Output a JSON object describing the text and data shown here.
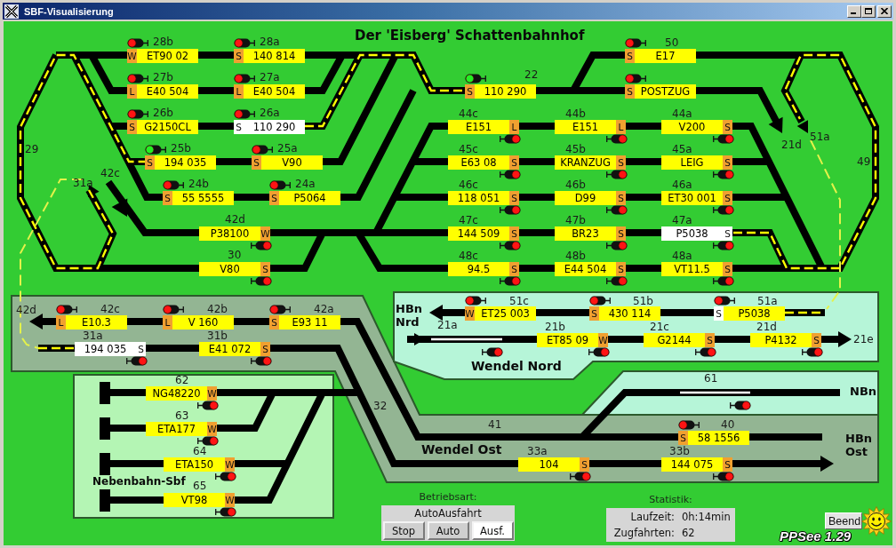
{
  "window": {
    "title": "SBF-Visualisierung"
  },
  "heading": "Der 'Eisberg' Schattenbahnhof",
  "blocks": [
    {
      "number": "28b",
      "train": "ET90 02",
      "letter": "W",
      "highlighted": false,
      "letter_highlighted": false,
      "signal_clear": false
    },
    {
      "number": "28a",
      "train": "140 814",
      "letter": "S",
      "highlighted": false,
      "letter_highlighted": false,
      "signal_clear": false
    },
    {
      "number": "50",
      "train": "E17",
      "letter": "S",
      "highlighted": false,
      "letter_highlighted": false,
      "signal_clear": false
    },
    {
      "number": "27b",
      "train": "E40 504",
      "letter": "L",
      "highlighted": false,
      "letter_highlighted": false,
      "signal_clear": false
    },
    {
      "number": "27a",
      "train": "E40 504",
      "letter": "L",
      "highlighted": false,
      "letter_highlighted": false,
      "signal_clear": false
    },
    {
      "number": "22",
      "train": "110 290",
      "letter": "S",
      "highlighted": false,
      "letter_highlighted": false,
      "signal_clear": true
    },
    {
      "train": "POSTZUG",
      "letter": "S",
      "highlighted": false,
      "letter_highlighted": false,
      "signal_clear": false
    },
    {
      "number": "26b",
      "train": "G2150CL",
      "letter": "S",
      "highlighted": false,
      "letter_highlighted": false,
      "signal_clear": false
    },
    {
      "number": "26a",
      "train": "110 290",
      "letter": "S",
      "highlighted": true,
      "letter_highlighted": true,
      "signal_clear": false
    },
    {
      "number": "44c",
      "train": "E151",
      "letter": "L",
      "highlighted": false,
      "letter_highlighted": false,
      "signal_clear": false
    },
    {
      "number": "44b",
      "train": "E151",
      "letter": "L",
      "highlighted": false,
      "letter_highlighted": false,
      "signal_clear": false
    },
    {
      "number": "44a",
      "train": "V200",
      "letter": "S",
      "highlighted": false,
      "letter_highlighted": false,
      "signal_clear": false
    },
    {
      "number": "25b",
      "train": "194 035",
      "letter": "S",
      "highlighted": false,
      "letter_highlighted": false,
      "signal_clear": true
    },
    {
      "number": "25a",
      "train": "V90",
      "letter": "S",
      "highlighted": false,
      "letter_highlighted": false,
      "signal_clear": false
    },
    {
      "number": "45c",
      "train": "E63 08",
      "letter": "S",
      "highlighted": false,
      "letter_highlighted": false,
      "signal_clear": false
    },
    {
      "number": "45b",
      "train": "KRANZUG",
      "letter": "S",
      "highlighted": false,
      "letter_highlighted": false,
      "signal_clear": false
    },
    {
      "number": "45a",
      "train": "LEIG",
      "letter": "S",
      "highlighted": false,
      "letter_highlighted": false,
      "signal_clear": false
    },
    {
      "number": "24b",
      "train": "55 5555",
      "letter": "S",
      "highlighted": false,
      "letter_highlighted": false,
      "signal_clear": false
    },
    {
      "number": "24a",
      "train": "P5064",
      "letter": "S",
      "highlighted": false,
      "letter_highlighted": false,
      "signal_clear": false
    },
    {
      "number": "46c",
      "train": "118 051",
      "letter": "S",
      "highlighted": false,
      "letter_highlighted": false,
      "signal_clear": false
    },
    {
      "number": "46b",
      "train": "D99",
      "letter": "S",
      "highlighted": false,
      "letter_highlighted": false,
      "signal_clear": false
    },
    {
      "number": "46a",
      "train": "ET30 001",
      "letter": "S",
      "highlighted": false,
      "letter_highlighted": false,
      "signal_clear": false
    },
    {
      "number": "42d",
      "train": "P38100",
      "letter": "W",
      "highlighted": false,
      "letter_highlighted": false,
      "signal_clear": false
    },
    {
      "number": "47c",
      "train": "144 509",
      "letter": "S",
      "highlighted": false,
      "letter_highlighted": false,
      "signal_clear": false
    },
    {
      "number": "47b",
      "train": "BR23",
      "letter": "S",
      "highlighted": false,
      "letter_highlighted": false,
      "signal_clear": false
    },
    {
      "number": "47a",
      "train": "P5038",
      "letter": "S",
      "highlighted": true,
      "letter_highlighted": true,
      "signal_clear": false
    },
    {
      "number": "30",
      "train": "V80",
      "letter": "S",
      "highlighted": false,
      "letter_highlighted": false,
      "signal_clear": false
    },
    {
      "number": "48c",
      "train": "94.5",
      "letter": "S",
      "highlighted": false,
      "letter_highlighted": false,
      "signal_clear": false
    },
    {
      "number": "48b",
      "train": "E44 504",
      "letter": "S",
      "highlighted": false,
      "letter_highlighted": false,
      "signal_clear": false
    },
    {
      "number": "48a",
      "train": "VT11.5",
      "letter": "S",
      "highlighted": false,
      "letter_highlighted": false,
      "signal_clear": false
    },
    {
      "number": "42c",
      "train": "E10.3",
      "letter": "L",
      "highlighted": false,
      "letter_highlighted": false,
      "signal_clear": false
    },
    {
      "number": "42b",
      "train": "V 160",
      "letter": "L",
      "highlighted": false,
      "letter_highlighted": false,
      "signal_clear": false
    },
    {
      "number": "42a",
      "train": "E93 11",
      "letter": "S",
      "highlighted": false,
      "letter_highlighted": false,
      "signal_clear": false
    },
    {
      "number": "51c",
      "train": "ET25 003",
      "letter": "W",
      "highlighted": false,
      "letter_highlighted": false,
      "signal_clear": false
    },
    {
      "number": "51b",
      "train": "430 114",
      "letter": "S",
      "highlighted": false,
      "letter_highlighted": false,
      "signal_clear": false
    },
    {
      "number": "51a",
      "train": "P5038",
      "letter": "S",
      "highlighted": false,
      "letter_highlighted": true,
      "signal_clear": false
    },
    {
      "number": "31a",
      "train": "194 035",
      "letter": "S",
      "highlighted": true,
      "letter_highlighted": true,
      "signal_clear": false
    },
    {
      "number": "31b",
      "train": "E41 072",
      "letter": "S",
      "highlighted": false,
      "letter_highlighted": false,
      "signal_clear": false
    },
    {
      "number": "21b",
      "train": "ET85 09",
      "letter": "W",
      "highlighted": false,
      "letter_highlighted": false,
      "signal_clear": false
    },
    {
      "number": "21c",
      "train": "G2144",
      "letter": "S",
      "highlighted": false,
      "letter_highlighted": false,
      "signal_clear": false
    },
    {
      "number": "21d",
      "train": "P4132",
      "letter": "S",
      "highlighted": false,
      "letter_highlighted": false,
      "signal_clear": false
    },
    {
      "number": "62",
      "train": "NG48220",
      "letter": "W",
      "highlighted": false,
      "letter_highlighted": false,
      "signal_clear": false
    },
    {
      "number": "63",
      "train": "ETA177",
      "letter": "W",
      "highlighted": false,
      "letter_highlighted": false,
      "signal_clear": false
    },
    {
      "number": "40",
      "train": "58 1556",
      "letter": "S",
      "highlighted": false,
      "letter_highlighted": false,
      "signal_clear": false
    },
    {
      "number": "64",
      "train": "ETA150",
      "letter": "W",
      "highlighted": false,
      "letter_highlighted": false,
      "signal_clear": false
    },
    {
      "number": "33a",
      "train": "104",
      "letter": "S",
      "highlighted": false,
      "letter_highlighted": false,
      "signal_clear": false
    },
    {
      "number": "33b",
      "train": "144 075",
      "letter": "S",
      "highlighted": false,
      "letter_highlighted": false,
      "signal_clear": false
    },
    {
      "number": "65",
      "train": "VT98",
      "letter": "W",
      "highlighted": false,
      "letter_highlighted": false,
      "signal_clear": false
    }
  ],
  "track_signals": [
    {
      "number": "21a",
      "signal_clear": false
    },
    {
      "number": "61",
      "signal_clear": false
    }
  ],
  "track_labels": [
    "51a",
    "21d",
    "29",
    "49",
    "42c",
    "31a",
    "42d",
    "21e",
    "32",
    "41"
  ],
  "area_labels": [
    "HBn Nrd",
    "Wendel Nord",
    "NBn",
    "HBn Ost",
    "Wendel Ost",
    "Nebenbahn-Sbf"
  ],
  "mode": {
    "label": "Betriebsart:",
    "status": "AutoAusfahrt",
    "buttons": [
      {
        "label": "Stop",
        "selected": false
      },
      {
        "label": "Auto",
        "selected": false
      },
      {
        "label": "Ausf.",
        "selected": true
      }
    ]
  },
  "statistics": {
    "title": "Statistik:",
    "rows": [
      {
        "label": "Laufzeit:",
        "value": "0h:14min"
      },
      {
        "label": "Zugfahrten:",
        "value": "62"
      }
    ]
  },
  "quit_button": {
    "label": "Beend"
  },
  "version": "PPSee 1.29"
}
